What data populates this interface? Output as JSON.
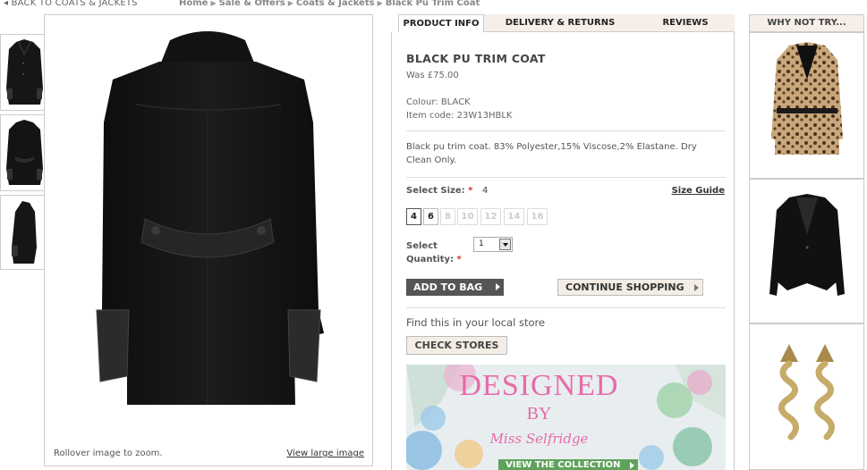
{
  "breadcrumb": {
    "back_label": "BACK TO COATS & JACKETS",
    "items": [
      "Home",
      "Sale & Offers",
      "Coats & Jackets",
      "Black Pu Trim Coat"
    ]
  },
  "gallery": {
    "rollover_text": "Rollover image to zoom.",
    "large_link": "View large image",
    "thumbnail_count": 3
  },
  "tabs": [
    "PRODUCT INFO",
    "DELIVERY & RETURNS",
    "REVIEWS"
  ],
  "product": {
    "title": "BLACK PU TRIM COAT",
    "was_price": "Was £75.00",
    "colour": "Colour: BLACK",
    "item_code": "Item code: 23W13HBLK",
    "description": "Black pu trim coat. 83% Polyester,15% Viscose,2% Elastane. Dry Clean Only.",
    "size_label": "Select Size:",
    "required_mark": "*",
    "selected_size": "4",
    "size_guide": "Size Guide",
    "sizes": [
      {
        "label": "4",
        "available": true
      },
      {
        "label": "6",
        "available": true
      },
      {
        "label": "8",
        "available": false
      },
      {
        "label": "10",
        "available": false
      },
      {
        "label": "12",
        "available": false
      },
      {
        "label": "14",
        "available": false
      },
      {
        "label": "16",
        "available": false
      }
    ],
    "quantity_label_1": "Select",
    "quantity_label_2": "Quantity:",
    "quantity_value": "1",
    "add_to_bag": "ADD TO BAG",
    "continue_shopping": "CONTINUE SHOPPING",
    "find_store": "Find this in your local store",
    "check_stores": "CHECK STORES"
  },
  "banner": {
    "line1": "DESIGNED",
    "line2": "BY",
    "signature": "Miss Selfridge",
    "cta": "VIEW THE COLLECTION"
  },
  "why_not_try": {
    "heading": "WHY NOT TRY...",
    "items": [
      "leopard-print-coat",
      "black-blazer",
      "gold-spiral-earrings"
    ]
  },
  "colors": {
    "accent_pink": "#e86aa9",
    "button_dark": "#555555",
    "button_light": "#f4ede6",
    "required_red": "#cc3333"
  }
}
